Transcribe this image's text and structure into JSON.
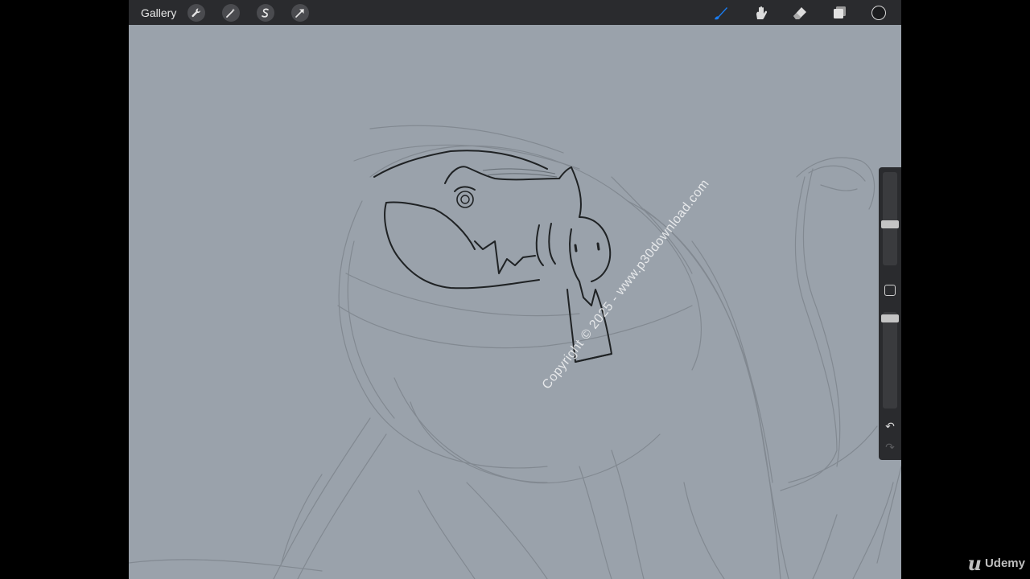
{
  "topbar": {
    "gallery_label": "Gallery",
    "left_tools": [
      {
        "icon": "wrench-icon"
      },
      {
        "icon": "magic-wand-icon"
      },
      {
        "icon": "selection-icon"
      },
      {
        "icon": "transform-arrow-icon"
      }
    ],
    "right_tools": [
      {
        "icon": "brush-icon",
        "active": true
      },
      {
        "icon": "smudge-icon"
      },
      {
        "icon": "eraser-icon"
      },
      {
        "icon": "layers-icon"
      },
      {
        "icon": "color-swatch-icon"
      }
    ],
    "active_color": "#1b1c1e",
    "accent": "#1a7cf0"
  },
  "sidebar": {
    "brush_size_level": 0.45,
    "opacity_level": 0.1,
    "icons": [
      "modify-button-icon",
      "undo-icon",
      "redo-icon"
    ]
  },
  "watermark": {
    "text": "Copyright © 2025 - www.p30download.com"
  },
  "brand": {
    "label": "Udemy"
  },
  "colors": {
    "canvas_bg": "#9aa2ab",
    "toolbar_bg": "#2a2b2e",
    "sketch_light": "#7e858d",
    "sketch_dark": "#1f2224"
  }
}
